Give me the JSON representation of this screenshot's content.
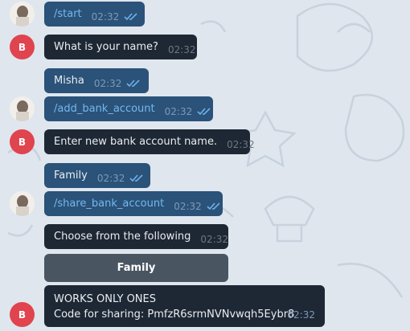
{
  "messages": [
    {
      "id": "m1",
      "text": "/start",
      "time": "02:32",
      "read": true
    },
    {
      "id": "m2",
      "text": "What is your name?",
      "time": "02:32"
    },
    {
      "id": "m3",
      "text": "Misha",
      "time": "02:32",
      "read": true
    },
    {
      "id": "m4",
      "text": "/add_bank_account",
      "time": "02:32",
      "read": true
    },
    {
      "id": "m5",
      "text": "Enter new bank account name.",
      "time": "02:32"
    },
    {
      "id": "m6",
      "text": "Family",
      "time": "02:32",
      "read": true
    },
    {
      "id": "m7",
      "text": "/share_bank_account",
      "time": "02:32",
      "read": true
    },
    {
      "id": "m8",
      "text": "Choose from the following",
      "time": "02:32"
    }
  ],
  "keyboard": {
    "button_label": "Family"
  },
  "final_message": {
    "line1": "WORKS ONLY ONES",
    "line2": "Code for sharing: PmfzR6srmNVNvwqh5Eybr8",
    "time": "02:32"
  },
  "bot_avatar": {
    "letter": "B",
    "color": "#e0444e"
  },
  "colors": {
    "outgoing": "#2b5278",
    "incoming": "#1e2734",
    "command": "#72b8f0",
    "background": "#dfe6ee"
  }
}
